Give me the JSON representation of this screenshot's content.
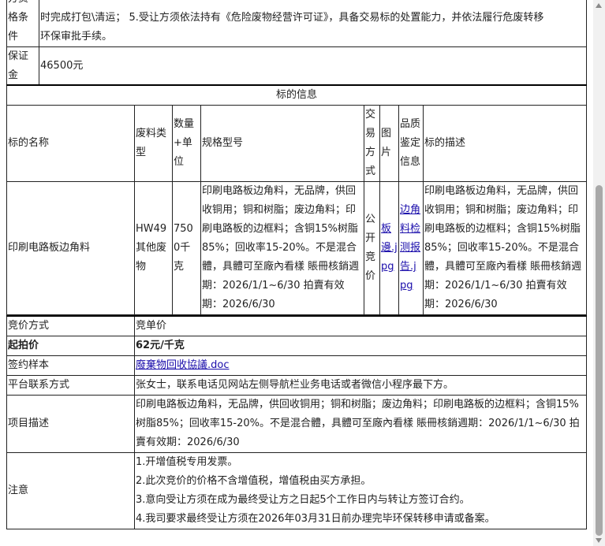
{
  "qualification": {
    "label": "方资格条件",
    "lines": [
      "时完成打包\\清运； 5.受让方须依法持有《危险废物经营许可证》，具备交易标的处置能力，并依法履行危废转移",
      "环保审批手续。"
    ]
  },
  "deposit": {
    "label": "保证金",
    "value": "46500元"
  },
  "subject": {
    "section_title": "标的信息",
    "headers": [
      "标的名称",
      "废料类型",
      "数量+单位",
      "规格型号",
      "交易方式",
      "图片",
      "品质鉴定信息",
      "标的描述"
    ],
    "row": {
      "name": "印刷电路板边角料",
      "waste_type": "HW49其他废物",
      "quantity": "7500千克",
      "spec": "印刷电路板边角料，无品牌，供回收铜用；铜和树脂；废边角料；印刷电路板的边框料；含铜15%树脂85%；回收率15-20%。不是混合體，具體可至廠內看樣 賬冊核銷週期：2026/1/1~6/30 拍賣有效期：2026/6/30",
      "trade_method": "公开竞价",
      "image_link": "板邊.jpg",
      "quality_link": "边角料检测报告.jpg",
      "description": "印刷电路板边角料，无品牌，供回收铜用；铜和树脂；废边角料；印刷电路板的边框料；含铜15%树脂85%；回收率15-20%。不是混合體，具體可至廠內看樣 賬冊核銷週期：2026/1/1~6/30 拍賣有效期：2026/6/30"
    }
  },
  "details": {
    "bid_method": {
      "label": "竞价方式",
      "value": "竞单价"
    },
    "start_price": {
      "label": "起拍价",
      "value": "62元/千克"
    },
    "contract_sample": {
      "label": "签约样本",
      "value": "廢棄物回收協議.doc"
    },
    "contact": {
      "label": "平台联系方式",
      "value": "张女士，联系电话见网站左侧导航栏业务电话或者微信小程序最下方。"
    },
    "project_desc": {
      "label": "项目描述",
      "value": "印刷电路板边角料，无品牌，供回收铜用；铜和树脂；废边角料；印刷电路板的边框料；含铜15%树脂85%；回收率15-20%。不是混合體，具體可至廠內看樣 賬冊核銷週期：2026/1/1~6/30 拍賣有效期：2026/6/30"
    },
    "notes": {
      "label": "注意",
      "items": [
        "1.开增值税专用发票。",
        "2.此次竞价的价格不含增值税，增值税由买方承担。",
        "3.意向受让方须在成为最终受让方之日起5个工作日内与转让方签订合约。",
        "4.我司要求最终受让方须在2026年03月31日前办理完毕环保转移申请或备案。"
      ]
    }
  }
}
